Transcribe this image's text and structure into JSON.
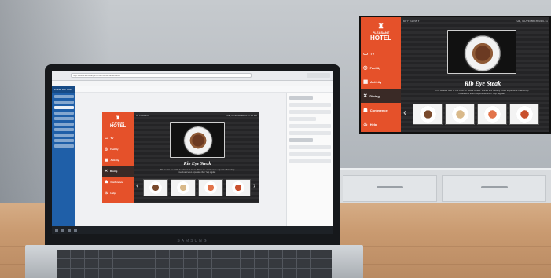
{
  "tv_display": {
    "logo_line1": "PLEASANT",
    "logo_line2": "HOTEL",
    "weather": "65°F SUNNY",
    "datetime": "TUE, NOVEMBER 05   07:1",
    "menu": [
      {
        "label": "TV",
        "icon": "tv-icon",
        "selected": false
      },
      {
        "label": "Facility",
        "icon": "facility-icon",
        "selected": false
      },
      {
        "label": "Activity",
        "icon": "activity-icon",
        "selected": false
      },
      {
        "label": "Dining",
        "icon": "dining-icon",
        "selected": true
      },
      {
        "label": "Conference",
        "icon": "conference-icon",
        "selected": false
      },
      {
        "label": "Help",
        "icon": "help-icon",
        "selected": false
      }
    ],
    "dish_title": "Rib Eye Steak",
    "dish_desc": "This week's one of the best for steak lovers. Prices are usually more expensive than chop meals and even expensive than Yelp regular.",
    "accent": "#e5512a",
    "thumb_colors": [
      "#7a4a2c",
      "#d9b98a",
      "#e2734a",
      "#c9502d"
    ]
  },
  "laptop_display": {
    "brand": "SAMSUNG",
    "url": "http://www.samsungvxt.com/cms/content/edit",
    "logo_line1": "PLEASANT",
    "logo_line2": "HOTEL",
    "weather": "65°F SUNNY",
    "datetime": "TUE, NOVEMBER 05   07:12 PM",
    "menu": [
      {
        "label": "TV",
        "selected": false
      },
      {
        "label": "Facility",
        "selected": false
      },
      {
        "label": "Activity",
        "selected": false
      },
      {
        "label": "Dining",
        "selected": true
      },
      {
        "label": "Conference",
        "selected": false
      },
      {
        "label": "Help",
        "selected": false
      }
    ],
    "dish_title": "Rib Eye Steak",
    "dish_desc": "This week's one of the best for steak lovers. Prices are usually more expensive than chop meals and even expensive than Yelp regular.",
    "cms_brand": "SAMSUNG VXT",
    "cms_blue": "#1f5fa8"
  }
}
